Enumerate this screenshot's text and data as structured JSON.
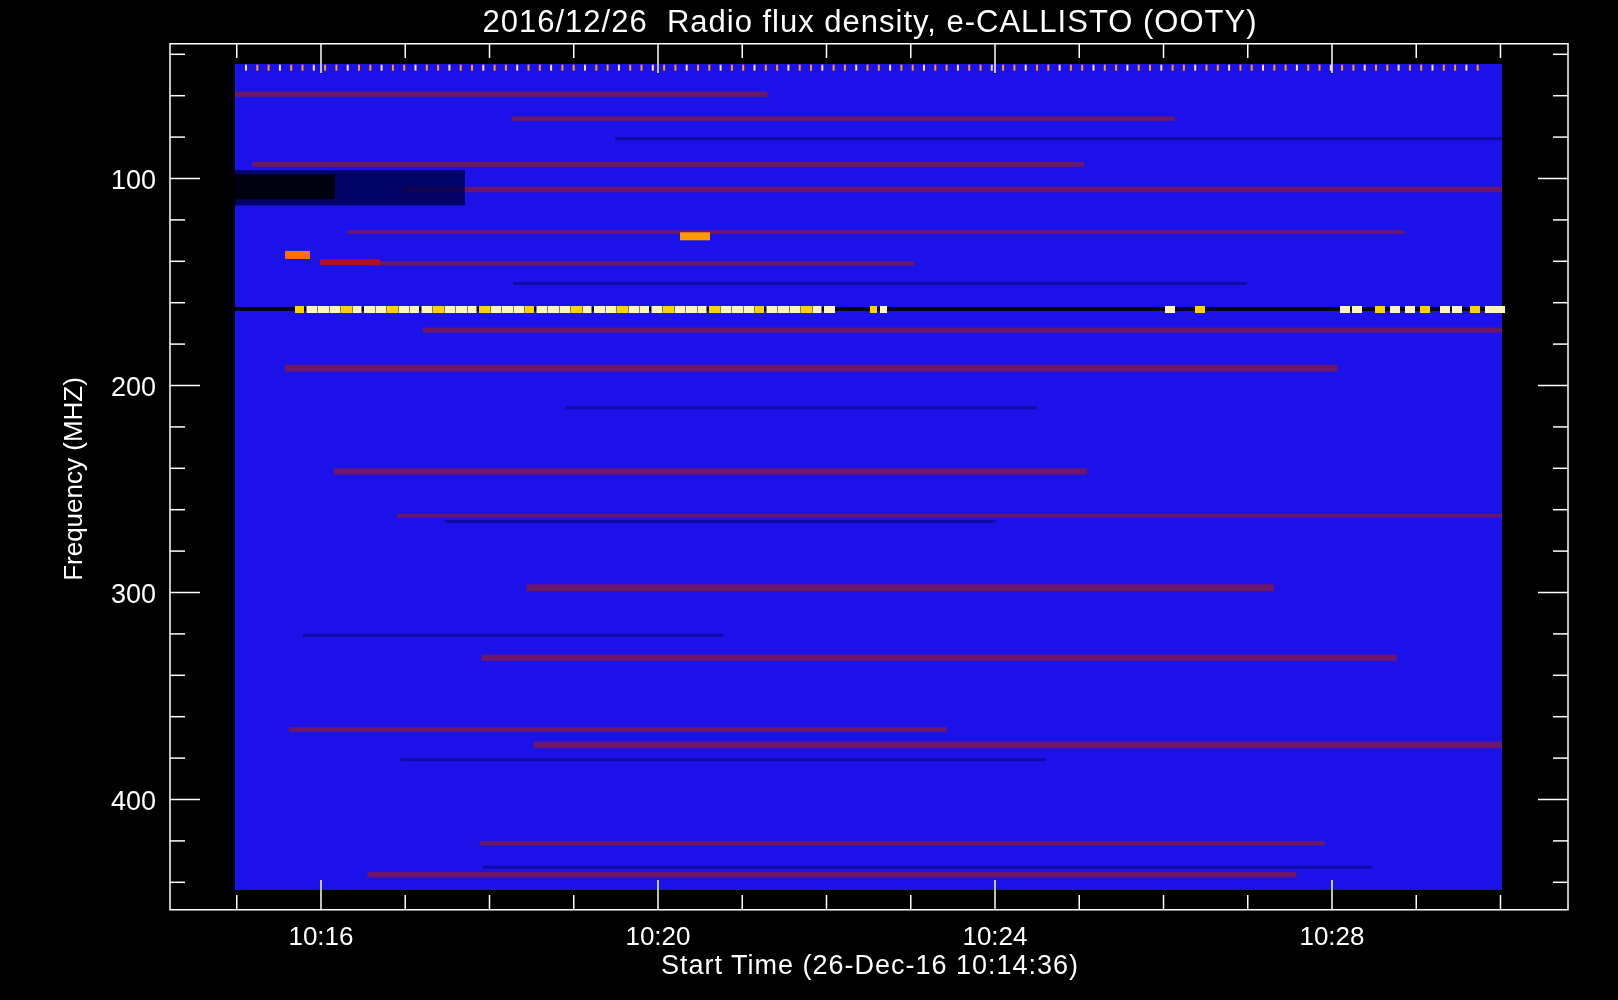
{
  "title": "2016/12/26  Radio flux density, e-CALLISTO (OOTY)",
  "y_axis": {
    "label": "Frequency (MHZ)",
    "tick_labels": [
      "100",
      "200",
      "300",
      "400"
    ]
  },
  "x_axis": {
    "label": "Start Time (26-Dec-16 10:14:36)",
    "tick_labels": [
      "10:16",
      "10:20",
      "10:24",
      "10:28"
    ]
  }
}
